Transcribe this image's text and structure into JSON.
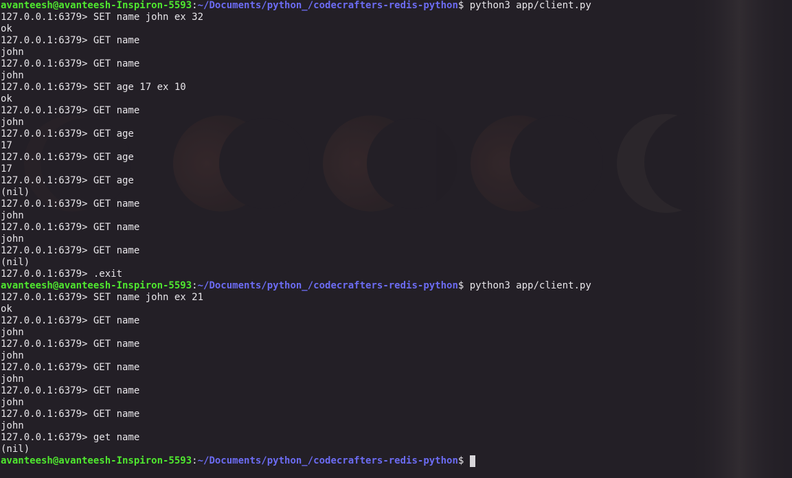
{
  "prompt": {
    "user_host": "avanteesh@avanteesh-Inspiron-5593",
    "separator": ":",
    "path": "~/Documents/python_/codecrafters-redis-python",
    "dollar": "$ "
  },
  "colors": {
    "user_host": "#4fe82f",
    "path": "#6c6cf3",
    "text": "#e8e6ea",
    "background": "#231f26"
  },
  "lines": [
    {
      "type": "shell",
      "command": "python3 app/client.py"
    },
    {
      "type": "text",
      "text": "127.0.0.1:6379> SET name john ex 32"
    },
    {
      "type": "text",
      "text": "ok"
    },
    {
      "type": "text",
      "text": "127.0.0.1:6379> GET name"
    },
    {
      "type": "text",
      "text": "john"
    },
    {
      "type": "text",
      "text": "127.0.0.1:6379> GET name"
    },
    {
      "type": "text",
      "text": "john"
    },
    {
      "type": "text",
      "text": "127.0.0.1:6379> SET age 17 ex 10"
    },
    {
      "type": "text",
      "text": "ok"
    },
    {
      "type": "text",
      "text": "127.0.0.1:6379> GET name"
    },
    {
      "type": "text",
      "text": "john"
    },
    {
      "type": "text",
      "text": "127.0.0.1:6379> GET age"
    },
    {
      "type": "text",
      "text": "17"
    },
    {
      "type": "text",
      "text": "127.0.0.1:6379> GET age"
    },
    {
      "type": "text",
      "text": "17"
    },
    {
      "type": "text",
      "text": "127.0.0.1:6379> GET age"
    },
    {
      "type": "text",
      "text": "(nil)"
    },
    {
      "type": "text",
      "text": "127.0.0.1:6379> GET name"
    },
    {
      "type": "text",
      "text": "john"
    },
    {
      "type": "text",
      "text": "127.0.0.1:6379> GET name"
    },
    {
      "type": "text",
      "text": "john"
    },
    {
      "type": "text",
      "text": "127.0.0.1:6379> GET name"
    },
    {
      "type": "text",
      "text": "(nil)"
    },
    {
      "type": "text",
      "text": "127.0.0.1:6379> .exit"
    },
    {
      "type": "shell",
      "command": "python3 app/client.py"
    },
    {
      "type": "text",
      "text": "127.0.0.1:6379> SET name john ex 21"
    },
    {
      "type": "text",
      "text": "ok"
    },
    {
      "type": "text",
      "text": "127.0.0.1:6379> GET name"
    },
    {
      "type": "text",
      "text": "john"
    },
    {
      "type": "text",
      "text": "127.0.0.1:6379> GET name"
    },
    {
      "type": "text",
      "text": "john"
    },
    {
      "type": "text",
      "text": "127.0.0.1:6379> GET name"
    },
    {
      "type": "text",
      "text": "john"
    },
    {
      "type": "text",
      "text": "127.0.0.1:6379> GET name"
    },
    {
      "type": "text",
      "text": "john"
    },
    {
      "type": "text",
      "text": "127.0.0.1:6379> GET name"
    },
    {
      "type": "text",
      "text": "john"
    },
    {
      "type": "text",
      "text": "127.0.0.1:6379> get name"
    },
    {
      "type": "text",
      "text": "(nil)"
    },
    {
      "type": "shell",
      "command": "",
      "cursor": true
    }
  ]
}
